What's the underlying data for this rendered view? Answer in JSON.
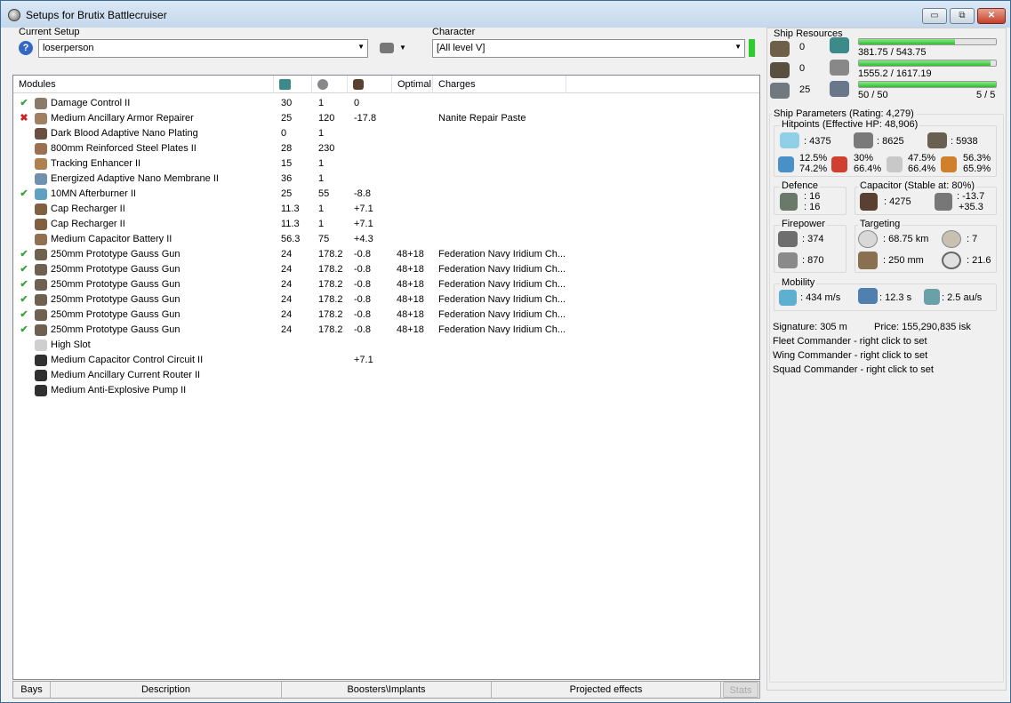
{
  "window": {
    "title": "Setups for Brutix Battlecruiser",
    "minimize": "▭",
    "restore": "⧉",
    "close": "✕"
  },
  "setup": {
    "label": "Current Setup",
    "value": "loserperson",
    "help_icon": "?"
  },
  "character": {
    "label": "Character",
    "value": "[All level V]"
  },
  "modules": {
    "headers": [
      "Modules",
      "",
      "",
      "",
      "Optimal",
      "Charges"
    ],
    "rows": [
      {
        "status": "ok",
        "name": "Damage Control II",
        "c1": "30",
        "c2": "1",
        "c3": "0",
        "optimal": "",
        "charges": "",
        "icon": "damage-control-icon",
        "color": "#8a7a6a"
      },
      {
        "status": "bad",
        "name": "Medium Ancillary Armor Repairer",
        "c1": "25",
        "c2": "120",
        "c3": "-17.8",
        "optimal": "",
        "charges": "Nanite Repair Paste",
        "icon": "armor-repairer-icon",
        "color": "#a08060"
      },
      {
        "status": "",
        "name": "Dark Blood Adaptive Nano Plating",
        "c1": "0",
        "c2": "1",
        "c3": "",
        "optimal": "",
        "charges": "",
        "icon": "nano-plating-icon",
        "color": "#6a5040"
      },
      {
        "status": "",
        "name": "800mm Reinforced Steel Plates II",
        "c1": "28",
        "c2": "230",
        "c3": "",
        "optimal": "",
        "charges": "",
        "icon": "steel-plates-icon",
        "color": "#9a7050"
      },
      {
        "status": "",
        "name": "Tracking Enhancer II",
        "c1": "15",
        "c2": "1",
        "c3": "",
        "optimal": "",
        "charges": "",
        "icon": "tracking-enhancer-icon",
        "color": "#b08050"
      },
      {
        "status": "",
        "name": "Energized Adaptive Nano Membrane II",
        "c1": "36",
        "c2": "1",
        "c3": "",
        "optimal": "",
        "charges": "",
        "icon": "nano-membrane-icon",
        "color": "#7090b0"
      },
      {
        "status": "ok",
        "name": "10MN Afterburner II",
        "c1": "25",
        "c2": "55",
        "c3": "-8.8",
        "optimal": "",
        "charges": "",
        "icon": "afterburner-icon",
        "color": "#60a0c0"
      },
      {
        "status": "",
        "name": "Cap Recharger II",
        "c1": "11.3",
        "c2": "1",
        "c3": "+7.1",
        "optimal": "",
        "charges": "",
        "icon": "cap-recharger-icon",
        "color": "#806040"
      },
      {
        "status": "",
        "name": "Cap Recharger II",
        "c1": "11.3",
        "c2": "1",
        "c3": "+7.1",
        "optimal": "",
        "charges": "",
        "icon": "cap-recharger-icon",
        "color": "#806040"
      },
      {
        "status": "",
        "name": "Medium Capacitor Battery II",
        "c1": "56.3",
        "c2": "75",
        "c3": "+4.3",
        "optimal": "",
        "charges": "",
        "icon": "capacitor-battery-icon",
        "color": "#907050"
      },
      {
        "status": "ok",
        "name": "250mm Prototype Gauss Gun",
        "c1": "24",
        "c2": "178.2",
        "c3": "-0.8",
        "optimal": "48+18",
        "charges": "Federation Navy Iridium Ch...",
        "icon": "gauss-gun-icon",
        "color": "#706050"
      },
      {
        "status": "ok",
        "name": "250mm Prototype Gauss Gun",
        "c1": "24",
        "c2": "178.2",
        "c3": "-0.8",
        "optimal": "48+18",
        "charges": "Federation Navy Iridium Ch...",
        "icon": "gauss-gun-icon",
        "color": "#706050"
      },
      {
        "status": "ok",
        "name": "250mm Prototype Gauss Gun",
        "c1": "24",
        "c2": "178.2",
        "c3": "-0.8",
        "optimal": "48+18",
        "charges": "Federation Navy Iridium Ch...",
        "icon": "gauss-gun-icon",
        "color": "#706050"
      },
      {
        "status": "ok",
        "name": "250mm Prototype Gauss Gun",
        "c1": "24",
        "c2": "178.2",
        "c3": "-0.8",
        "optimal": "48+18",
        "charges": "Federation Navy Iridium Ch...",
        "icon": "gauss-gun-icon",
        "color": "#706050"
      },
      {
        "status": "ok",
        "name": "250mm Prototype Gauss Gun",
        "c1": "24",
        "c2": "178.2",
        "c3": "-0.8",
        "optimal": "48+18",
        "charges": "Federation Navy Iridium Ch...",
        "icon": "gauss-gun-icon",
        "color": "#706050"
      },
      {
        "status": "ok",
        "name": "250mm Prototype Gauss Gun",
        "c1": "24",
        "c2": "178.2",
        "c3": "-0.8",
        "optimal": "48+18",
        "charges": "Federation Navy Iridium Ch...",
        "icon": "gauss-gun-icon",
        "color": "#706050"
      },
      {
        "status": "",
        "name": "High Slot",
        "c1": "",
        "c2": "",
        "c3": "",
        "optimal": "",
        "charges": "",
        "icon": "high-slot-icon",
        "color": "#cfcfcf"
      },
      {
        "status": "",
        "name": "Medium Capacitor Control Circuit II",
        "c1": "",
        "c2": "",
        "c3": "+7.1",
        "optimal": "",
        "charges": "",
        "icon": "rig-icon",
        "color": "#303030"
      },
      {
        "status": "",
        "name": "Medium Ancillary Current Router II",
        "c1": "",
        "c2": "",
        "c3": "",
        "optimal": "",
        "charges": "",
        "icon": "rig-icon",
        "color": "#303030"
      },
      {
        "status": "",
        "name": "Medium Anti-Explosive Pump II",
        "c1": "",
        "c2": "",
        "c3": "",
        "optimal": "",
        "charges": "",
        "icon": "rig-icon",
        "color": "#303030"
      }
    ]
  },
  "bottom_tabs": [
    "Bays",
    "Description",
    "Boosters\\Implants",
    "Projected effects",
    "Stats"
  ],
  "resources": {
    "label": "Ship Resources",
    "turret": "0",
    "launcher": "0",
    "drone": "25",
    "cpu": "381.75 / 543.75",
    "cpu_fill": 0.7,
    "power": "1555.2 / 1617.19",
    "power_fill": 0.96,
    "calibration": "50 / 50",
    "calibration_fill": 1.0,
    "rigs": "5 / 5"
  },
  "params": {
    "label": "Ship Parameters (Rating: 4,279)",
    "hitpoints_label": "Hitpoints (Effective HP: 48,906)",
    "shield_hp": ": 4375",
    "armor_hp": ": 8625",
    "structure_hp": ": 5938",
    "em": [
      "12.5%",
      "74.2%"
    ],
    "thermal": [
      "30%",
      "66.4%"
    ],
    "kinetic": [
      "47.5%",
      "66.4%"
    ],
    "explosive": [
      "56.3%",
      "65.9%"
    ],
    "defence_label": "Defence",
    "defence_1": ": 16",
    "defence_2": ": 16",
    "capacitor_label": "Capacitor (Stable at: 80%)",
    "capacitor_value": ": 4275",
    "cap_delta_1": ": -13.7",
    "cap_delta_2": "+35.3",
    "firepower_label": "Firepower",
    "dps": ": 374",
    "volley": ": 870",
    "targeting_label": "Targeting",
    "range": ": 68.75 km",
    "targets": ": 7",
    "sig_res": ": 250 mm",
    "scan": ": 21.6",
    "mobility_label": "Mobility",
    "speed": ": 434 m/s",
    "align": ": 12.3 s",
    "warp": ": 2.5 au/s",
    "signature": "Signature: 305 m",
    "price": "Price: 155,290,835 isk",
    "fleet": "Fleet Commander - right click to set",
    "wing": "Wing Commander - right click to set",
    "squad": "Squad Commander - right click to set"
  }
}
